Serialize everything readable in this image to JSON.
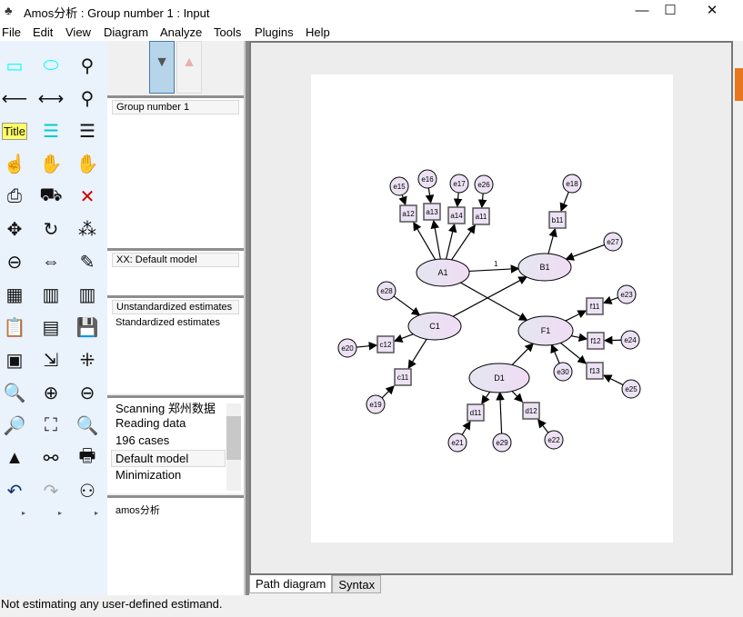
{
  "window": {
    "title": "Amos分析 : Group number 1 : Input",
    "minimize": "—",
    "maximize": "☐",
    "close": "✕"
  },
  "menu": [
    "File",
    "Edit",
    "View",
    "Diagram",
    "Analyze",
    "Tools",
    "Plugins",
    "Help"
  ],
  "toolbox": {
    "title_tool": "Title"
  },
  "panels": {
    "groups": [
      "Group number 1"
    ],
    "models": [
      "XX: Default model"
    ],
    "estimates": [
      "Unstandardized estimates",
      "Standardized estimates"
    ],
    "log": [
      "Scanning 郑州数据",
      "Reading data",
      "196 cases",
      "Default model",
      "Minimization"
    ],
    "files": [
      "amos分析"
    ]
  },
  "diagram": {
    "latent": [
      {
        "id": "A1",
        "label": "A1"
      },
      {
        "id": "B1",
        "label": "B1"
      },
      {
        "id": "C1",
        "label": "C1"
      },
      {
        "id": "F1",
        "label": "F1"
      },
      {
        "id": "D1",
        "label": "D1"
      }
    ],
    "observed": [
      "a12",
      "a13",
      "a14",
      "a11",
      "b11",
      "f11",
      "f12",
      "f13",
      "c12",
      "c11",
      "d11",
      "d12"
    ],
    "errors": [
      "e15",
      "e16",
      "e17",
      "e26",
      "e18",
      "e27",
      "e23",
      "e24",
      "e25",
      "e28",
      "e20",
      "e19",
      "e30",
      "e21",
      "e29",
      "e22"
    ],
    "path_label": "1"
  },
  "tabs": [
    {
      "label": "Path diagram",
      "active": true
    },
    {
      "label": "Syntax",
      "active": false
    }
  ],
  "status": "Not estimating any user-defined estimand.",
  "colors": {
    "node_fill": "#ece2f4",
    "toolbox_bg": "#eaf2fc",
    "accent": "#e8761e"
  }
}
